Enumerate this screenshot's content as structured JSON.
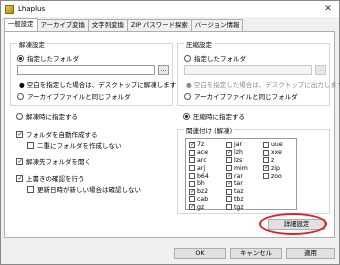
{
  "window": {
    "title": "Lhaplus",
    "close": "✕"
  },
  "tabs": [
    "一般設定",
    "アーカイブ変換",
    "文字列変換",
    "ZIP パスワード探索",
    "バージョン情報"
  ],
  "extract": {
    "group_title": "解凍設定",
    "opt_folder": "指定したフォルダ",
    "browse": "...",
    "hint": "● 空白を指定した場合は、デスクトップに解凍します",
    "opt_same": "アーカイブファイルと同じフォルダ",
    "opt_each": "解凍時に指定する",
    "auto_create": "フォルダを自動作成する",
    "no_double": "二重にフォルダを作成しない",
    "open_folder": "解凍先フォルダを開く",
    "confirm_overwrite": "上書きの確認を行う",
    "skip_newer": "更新日時が新しい場合は確認しない"
  },
  "compress": {
    "group_title": "圧縮設定",
    "opt_folder": "指定したフォルダ",
    "browse": "...",
    "hint": "● 空白を指定した場合は、デスクトップに出力します",
    "opt_same": "アーカイブファイルと同じフォルダ",
    "opt_each": "圧縮時に指定する"
  },
  "assoc": {
    "group_title": "関連付け (解凍)",
    "col1": [
      {
        "ext": "7z",
        "on": true
      },
      {
        "ext": "ace",
        "on": false
      },
      {
        "ext": "arc",
        "on": false
      },
      {
        "ext": "arj",
        "on": false
      },
      {
        "ext": "b64",
        "on": false
      },
      {
        "ext": "bh",
        "on": false
      },
      {
        "ext": "bz2",
        "on": true
      },
      {
        "ext": "cab",
        "on": false
      },
      {
        "ext": "gz",
        "on": true
      }
    ],
    "col2": [
      {
        "ext": "jar",
        "on": false
      },
      {
        "ext": "lzh",
        "on": true
      },
      {
        "ext": "lzs",
        "on": false
      },
      {
        "ext": "mim",
        "on": false
      },
      {
        "ext": "rar",
        "on": true
      },
      {
        "ext": "tar",
        "on": true
      },
      {
        "ext": "taz",
        "on": false
      },
      {
        "ext": "tbz",
        "on": false
      },
      {
        "ext": "tgz",
        "on": false
      }
    ],
    "col3": [
      {
        "ext": "uue",
        "on": false
      },
      {
        "ext": "xxe",
        "on": false
      },
      {
        "ext": "z",
        "on": false
      },
      {
        "ext": "zip",
        "on": true
      },
      {
        "ext": "zoo",
        "on": false
      }
    ]
  },
  "buttons": {
    "details": "詳細設定",
    "ok": "OK",
    "cancel": "キャンセル",
    "apply": "適用"
  },
  "colors": {
    "highlight": "#e02020"
  }
}
